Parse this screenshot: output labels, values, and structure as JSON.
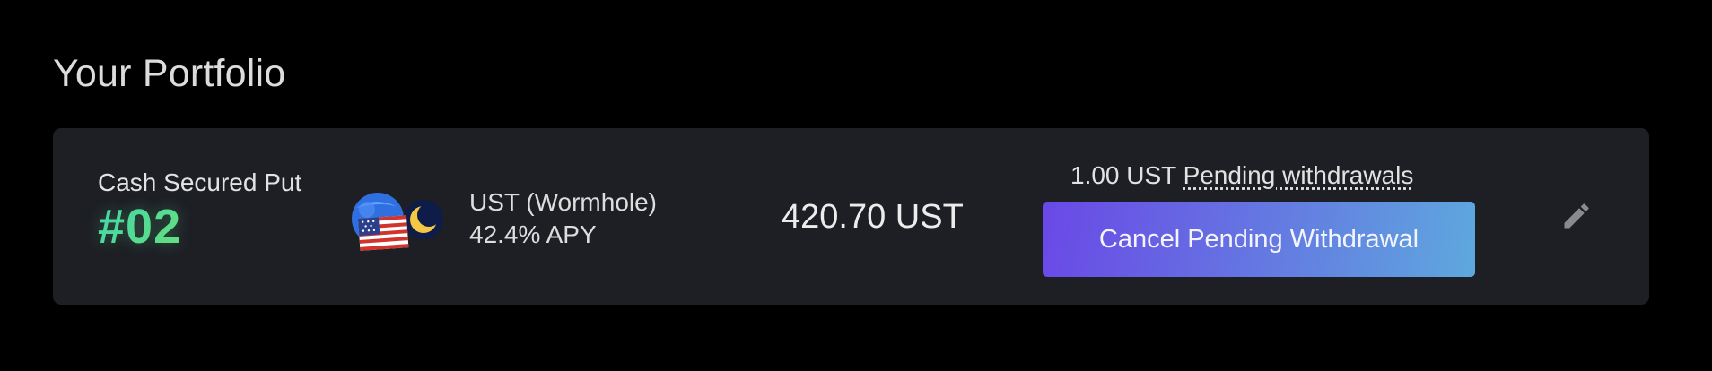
{
  "page": {
    "title": "Your Portfolio"
  },
  "position": {
    "strategy_name": "Cash Secured Put",
    "strategy_id": "#02",
    "asset_name": "UST (Wormhole)",
    "apy": "42.4% APY",
    "icons": [
      "us-flag-icon",
      "terra-luna-icon"
    ],
    "balance": "420.70 UST",
    "pending_amount": "1.00 UST",
    "pending_label": "Pending withdrawals",
    "cancel_label": "Cancel Pending Withdrawal",
    "edit_icon": "pencil-icon"
  },
  "colors": {
    "background": "#000000",
    "card": "#1e1f25",
    "id_gradient_start": "#3fd7b2",
    "id_gradient_end": "#9fe45f",
    "button_gradient_start": "#6a48e6",
    "button_gradient_end": "#5ea8de"
  }
}
